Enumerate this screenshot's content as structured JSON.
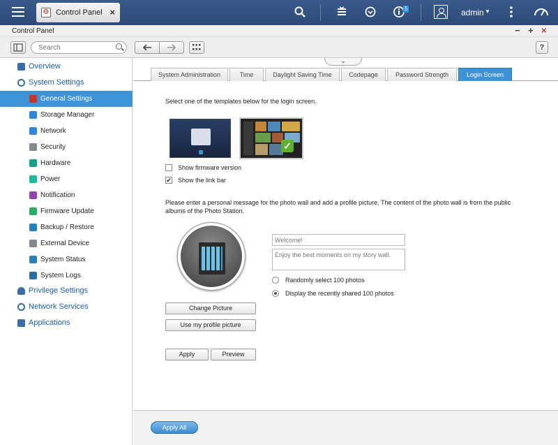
{
  "topbar": {
    "tab_title": "Control Panel",
    "user": "admin",
    "notification_count": "5",
    "icons": [
      "menu-icon",
      "search-icon",
      "stack-icon",
      "sync-icon",
      "info-icon",
      "user-icon",
      "more-icon",
      "dashboard-icon"
    ]
  },
  "window": {
    "title": "Control Panel"
  },
  "toolbar": {
    "search_placeholder": "Search"
  },
  "sidebar": {
    "overview": "Overview",
    "system_settings": "System Settings",
    "items": [
      {
        "label": "General Settings",
        "icon": "general-settings-icon",
        "color": "#c0392b"
      },
      {
        "label": "Storage Manager",
        "icon": "storage-icon",
        "color": "#2e86de"
      },
      {
        "label": "Network",
        "icon": "network-icon",
        "color": "#2e86de"
      },
      {
        "label": "Security",
        "icon": "lock-icon",
        "color": "#7f8c8d"
      },
      {
        "label": "Hardware",
        "icon": "hardware-icon",
        "color": "#16a085"
      },
      {
        "label": "Power",
        "icon": "power-icon",
        "color": "#1abc9c"
      },
      {
        "label": "Notification",
        "icon": "notification-icon",
        "color": "#8e44ad"
      },
      {
        "label": "Firmware Update",
        "icon": "firmware-icon",
        "color": "#27ae60"
      },
      {
        "label": "Backup / Restore",
        "icon": "backup-icon",
        "color": "#2980b9"
      },
      {
        "label": "External Device",
        "icon": "external-device-icon",
        "color": "#7f8c8d"
      },
      {
        "label": "System Status",
        "icon": "system-status-icon",
        "color": "#2980b9"
      },
      {
        "label": "System Logs",
        "icon": "system-logs-icon",
        "color": "#2471a3"
      }
    ],
    "privilege_settings": "Privilege Settings",
    "network_services": "Network Services",
    "applications": "Applications"
  },
  "tabs": [
    "System Administration",
    "Time",
    "Daylight Saving Time",
    "Codepage",
    "Password Strength",
    "Login Screen"
  ],
  "active_tab": "Login Screen",
  "login_screen": {
    "intro": "Select one of the templates below for the login screen.",
    "show_firmware_version": "Show firmware version",
    "show_firmware_checked": false,
    "show_link_bar": "Show the link bar",
    "show_link_bar_checked": true,
    "photo_wall_msg_1": "Please enter a personal message for the photo wall and add a profile picture. The content of the photo wall is from the public",
    "photo_wall_msg_2": "albums of the Photo Station.",
    "title_value": "Welcome!",
    "message_value": "Enjoy the best moments on my story wall.",
    "radio_random": "Randomly select 100 photos",
    "radio_recent": "Display the recently shared 100 photos",
    "selected_radio": "recent",
    "change_picture": "Change Picture",
    "use_profile_picture": "Use my profile picture",
    "apply": "Apply",
    "preview": "Preview"
  },
  "footer": {
    "apply_all": "Apply All"
  },
  "colors": {
    "accent": "#3e92d6",
    "topbar": "#2c4a78"
  }
}
